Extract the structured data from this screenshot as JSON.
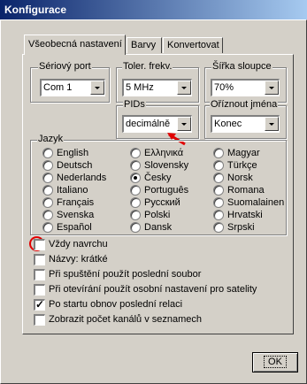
{
  "window": {
    "title": "Konfigurace"
  },
  "tabs": [
    {
      "label": "Všeobecná nastavení",
      "active": true
    },
    {
      "label": "Barvy",
      "active": false
    },
    {
      "label": "Konvertovat",
      "active": false
    }
  ],
  "groups": {
    "serial_port": {
      "label": "Sériový port",
      "value": "Com 1"
    },
    "freq_tolerance": {
      "label": "Toler. frekv.",
      "value": "5 MHz"
    },
    "column_width": {
      "label": "Šířka sloupce",
      "value": "70%"
    },
    "pids": {
      "label": "PIDs",
      "value": "decimálně"
    },
    "name_truncate": {
      "label": "Oříznout jména",
      "value": "Konec"
    }
  },
  "language": {
    "label": "Jazyk",
    "options": [
      "English",
      "Deutsch",
      "Nederlands",
      "Italiano",
      "Français",
      "Svenska",
      "Español",
      "Ελληνικά",
      "Slovensky",
      "Česky",
      "Português",
      "Русский",
      "Polski",
      "Dansk",
      "Magyar",
      "Türkçe",
      "Norsk",
      "Romana",
      "Suomalainen",
      "Hrvatski",
      "Srpski"
    ],
    "selected": "Česky"
  },
  "checkboxes": [
    {
      "label": "Vždy navrchu",
      "checked": false
    },
    {
      "label": "Názvy: krátké",
      "checked": false
    },
    {
      "label": "Při spuštění použít poslední soubor",
      "checked": false
    },
    {
      "label": "Při otevírání použít osobní nastavení pro satelity",
      "checked": false
    },
    {
      "label": "Po startu obnov poslední relaci",
      "checked": true
    },
    {
      "label": "Zobrazit počet kanálů v seznamech",
      "checked": false
    }
  ],
  "buttons": {
    "ok": "OK"
  },
  "annotations": {
    "highlight_color": "#e00000"
  }
}
